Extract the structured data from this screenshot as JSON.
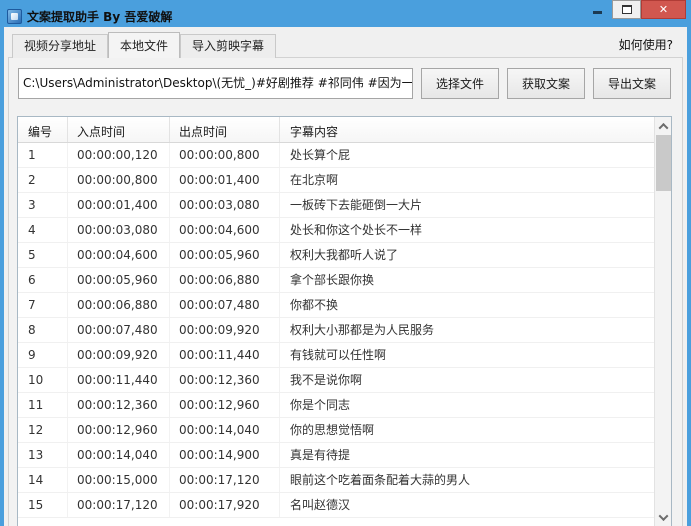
{
  "window": {
    "title": "文案提取助手 By 吾爱破解"
  },
  "tabs": [
    {
      "label": "视频分享地址",
      "active": false
    },
    {
      "label": "本地文件",
      "active": true
    },
    {
      "label": "导入剪映字幕",
      "active": false
    }
  ],
  "help_link": "如何使用?",
  "file_section": {
    "path_value": "C:\\Users\\Administrator\\Desktop\\(无忧_)#好剧推荐 #祁同伟 #因为一个",
    "select_button": "选择文件",
    "fetch_button": "获取文案",
    "export_button": "导出文案"
  },
  "table": {
    "columns": [
      "编号",
      "入点时间",
      "出点时间",
      "字幕内容"
    ],
    "rows": [
      {
        "id": "1",
        "in": "00:00:00,120",
        "out": "00:00:00,800",
        "text": "处长算个屁"
      },
      {
        "id": "2",
        "in": "00:00:00,800",
        "out": "00:00:01,400",
        "text": "在北京啊"
      },
      {
        "id": "3",
        "in": "00:00:01,400",
        "out": "00:00:03,080",
        "text": "一板砖下去能砸倒一大片"
      },
      {
        "id": "4",
        "in": "00:00:03,080",
        "out": "00:00:04,600",
        "text": "处长和你这个处长不一样"
      },
      {
        "id": "5",
        "in": "00:00:04,600",
        "out": "00:00:05,960",
        "text": "权利大我都听人说了"
      },
      {
        "id": "6",
        "in": "00:00:05,960",
        "out": "00:00:06,880",
        "text": "拿个部长跟你换"
      },
      {
        "id": "7",
        "in": "00:00:06,880",
        "out": "00:00:07,480",
        "text": "你都不换"
      },
      {
        "id": "8",
        "in": "00:00:07,480",
        "out": "00:00:09,920",
        "text": "权利大小那都是为人民服务"
      },
      {
        "id": "9",
        "in": "00:00:09,920",
        "out": "00:00:11,440",
        "text": "有钱就可以任性啊"
      },
      {
        "id": "10",
        "in": "00:00:11,440",
        "out": "00:00:12,360",
        "text": "我不是说你啊"
      },
      {
        "id": "11",
        "in": "00:00:12,360",
        "out": "00:00:12,960",
        "text": "你是个同志"
      },
      {
        "id": "12",
        "in": "00:00:12,960",
        "out": "00:00:14,040",
        "text": "你的思想觉悟啊"
      },
      {
        "id": "13",
        "in": "00:00:14,040",
        "out": "00:00:14,900",
        "text": "真是有待提"
      },
      {
        "id": "14",
        "in": "00:00:15,000",
        "out": "00:00:17,120",
        "text": "眼前这个吃着面条配着大蒜的男人"
      },
      {
        "id": "15",
        "in": "00:00:17,120",
        "out": "00:00:17,920",
        "text": "名叫赵德汉"
      }
    ]
  }
}
